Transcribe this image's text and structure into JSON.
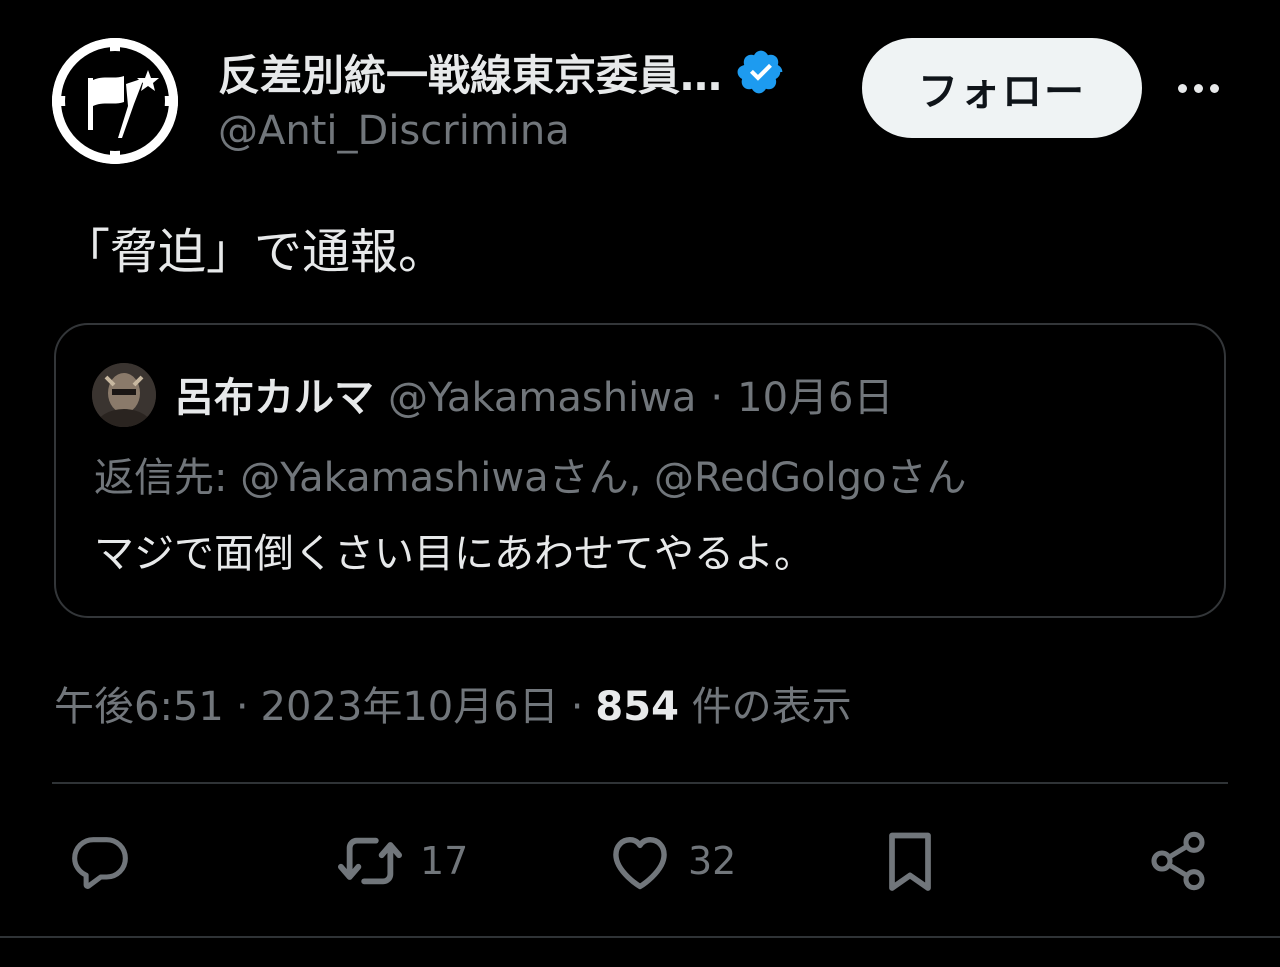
{
  "author": {
    "display_name": "反差別統一戦線東京委員…",
    "handle": "@Anti_Discrimina",
    "verified": true,
    "avatar_icon": "antifa-flag-logo"
  },
  "follow_label": "フォロー",
  "tweet": {
    "text": "「脅迫」で通報。"
  },
  "quote": {
    "author_name": "呂布カルマ",
    "author_handle": "@Yakamashiwa",
    "separator": "·",
    "date": "10月6日",
    "reply_to": "返信先: @Yakamashiwaさん, @RedGolgoさん",
    "text": "マジで面倒くさい目にあわせてやるよ。"
  },
  "meta": {
    "time": "午後6:51",
    "separator": "·",
    "date": "2023年10月6日",
    "views_count": "854",
    "views_label": "件の表示"
  },
  "actions": {
    "reply_icon": "reply-icon",
    "retweet_icon": "retweet-icon",
    "retweet_count": "17",
    "like_icon": "heart-icon",
    "like_count": "32",
    "bookmark_icon": "bookmark-icon",
    "share_icon": "share-icon"
  },
  "colors": {
    "background": "#000000",
    "text": "#e7e9ea",
    "muted": "#71767b",
    "verified_blue": "#1d9bf0",
    "border": "#333639"
  }
}
